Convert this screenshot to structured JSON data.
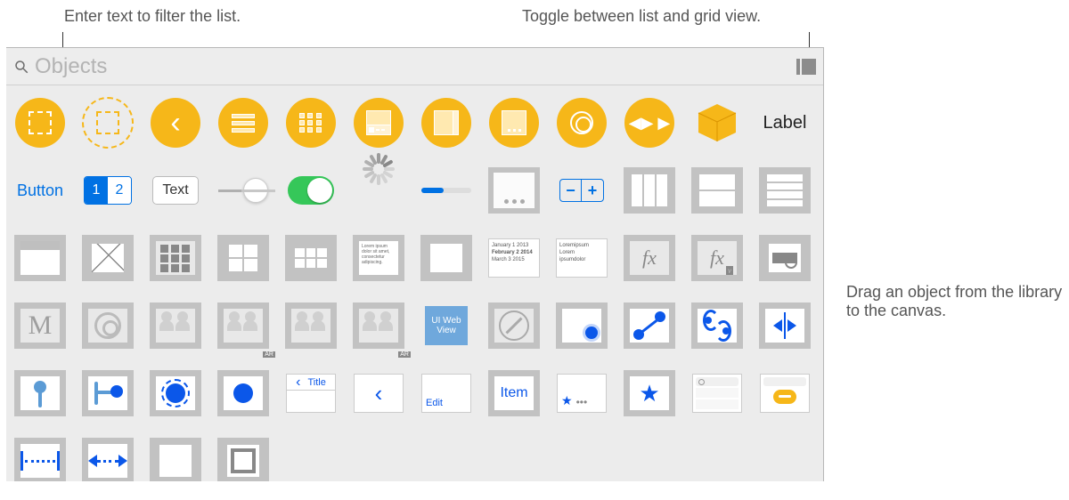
{
  "annotations": {
    "filter": "Enter text to filter the list.",
    "toggle": "Toggle between list and grid view.",
    "drag": "Drag an object from the library to the canvas."
  },
  "search": {
    "placeholder": "Objects"
  },
  "row1": {
    "label_text": "Label"
  },
  "row2": {
    "button": "Button",
    "seg_on": "1",
    "seg_off": "2",
    "textfield": "Text"
  },
  "row3": {
    "lorem": "Lorem ipsum dolor sit amet, consectetur adipiscing.",
    "date1": "January  1  2013",
    "date2": "February 2  2014",
    "date3": "March    3  2015",
    "lorem2": "Loremipsum\nLorem\nipsumdolor",
    "fx": "fx"
  },
  "row4": {
    "m": "M",
    "ar": "AR",
    "webview": "UI Web View"
  },
  "row5": {
    "nav_title": "Title",
    "edit": "Edit",
    "item": "Item"
  }
}
